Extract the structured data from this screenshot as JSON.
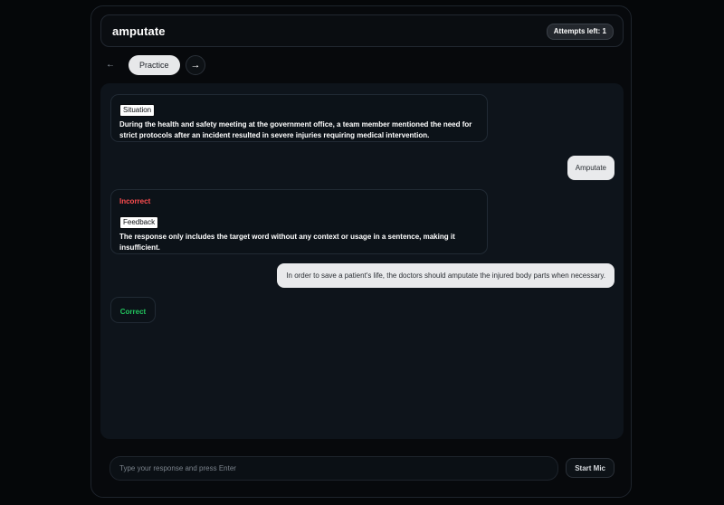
{
  "header": {
    "title": "amputate",
    "attempts_label": "Attempts left: 1"
  },
  "nav": {
    "back_icon": "arrow-left-icon",
    "mode_label": "Practice",
    "next_icon": "arrow-right-icon",
    "back_glyph": "←",
    "next_glyph": "→"
  },
  "chat": {
    "situation": {
      "tag": "Situation",
      "text": "During the health and safety meeting at the government office, a team member mentioned the need for strict protocols after an incident resulted in severe injuries requiring medical intervention."
    },
    "user_message_1": "Amputate",
    "feedback_1": {
      "status": "Incorrect",
      "tag": "Feedback",
      "text": "The response only includes the target word without any context or usage in a sentence, making it insufficient."
    },
    "user_message_2": "In order to save a patient's life, the doctors should amputate the injured body parts when necessary.",
    "feedback_2": {
      "status": "Correct"
    }
  },
  "composer": {
    "placeholder": "Type your response and press Enter",
    "mic_label": "Start Mic"
  },
  "colors": {
    "incorrect": "#ff4d4f",
    "correct": "#22c55e",
    "background": "#050709",
    "panel": "#0e141b"
  }
}
